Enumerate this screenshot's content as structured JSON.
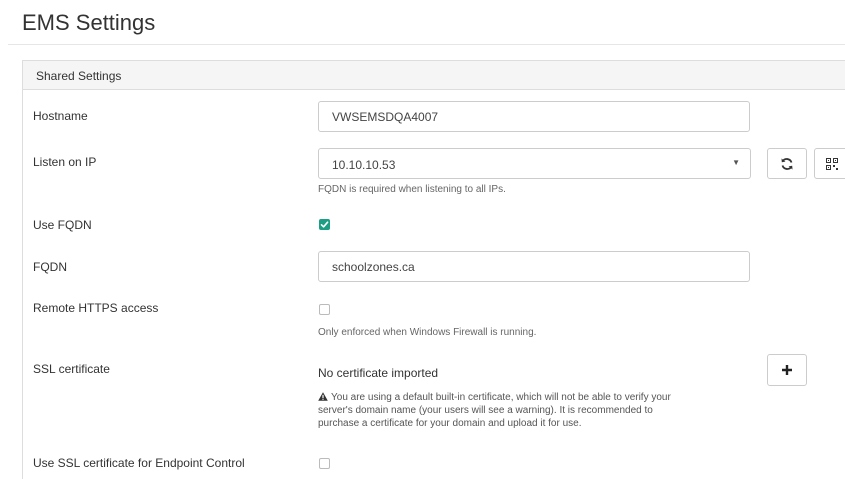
{
  "page": {
    "title": "EMS Settings"
  },
  "panel": {
    "heading": "Shared Settings"
  },
  "hostname": {
    "label": "Hostname",
    "value": "VWSEMSDQA4007"
  },
  "listen_ip": {
    "label": "Listen on IP",
    "value": "10.10.10.53",
    "help": "FQDN is required when listening to all IPs.",
    "refresh_icon": "refresh-icon",
    "qr_icon": "qr-code-icon"
  },
  "use_fqdn": {
    "label": "Use FQDN",
    "checked": true
  },
  "fqdn": {
    "label": "FQDN",
    "value": "schoolzones.ca"
  },
  "remote_https": {
    "label": "Remote HTTPS access",
    "checked": false,
    "help": "Only enforced when Windows Firewall is running."
  },
  "ssl": {
    "label": "SSL certificate",
    "status": "No certificate imported",
    "warning_line1": "You are using a default built-in certificate, which will not be able to verify your",
    "warning_line2": "server's domain name (your users will see a warning). It is recommended to",
    "warning_line3": "purchase a certificate for your domain and upload it for use.",
    "add_icon": "plus-icon"
  },
  "ssl_endpoint": {
    "label": "Use SSL certificate for Endpoint Control",
    "checked": false
  },
  "colors": {
    "accent": "#1b9e83",
    "border": "#cccccc",
    "panel_heading_bg": "#f5f5f5"
  }
}
